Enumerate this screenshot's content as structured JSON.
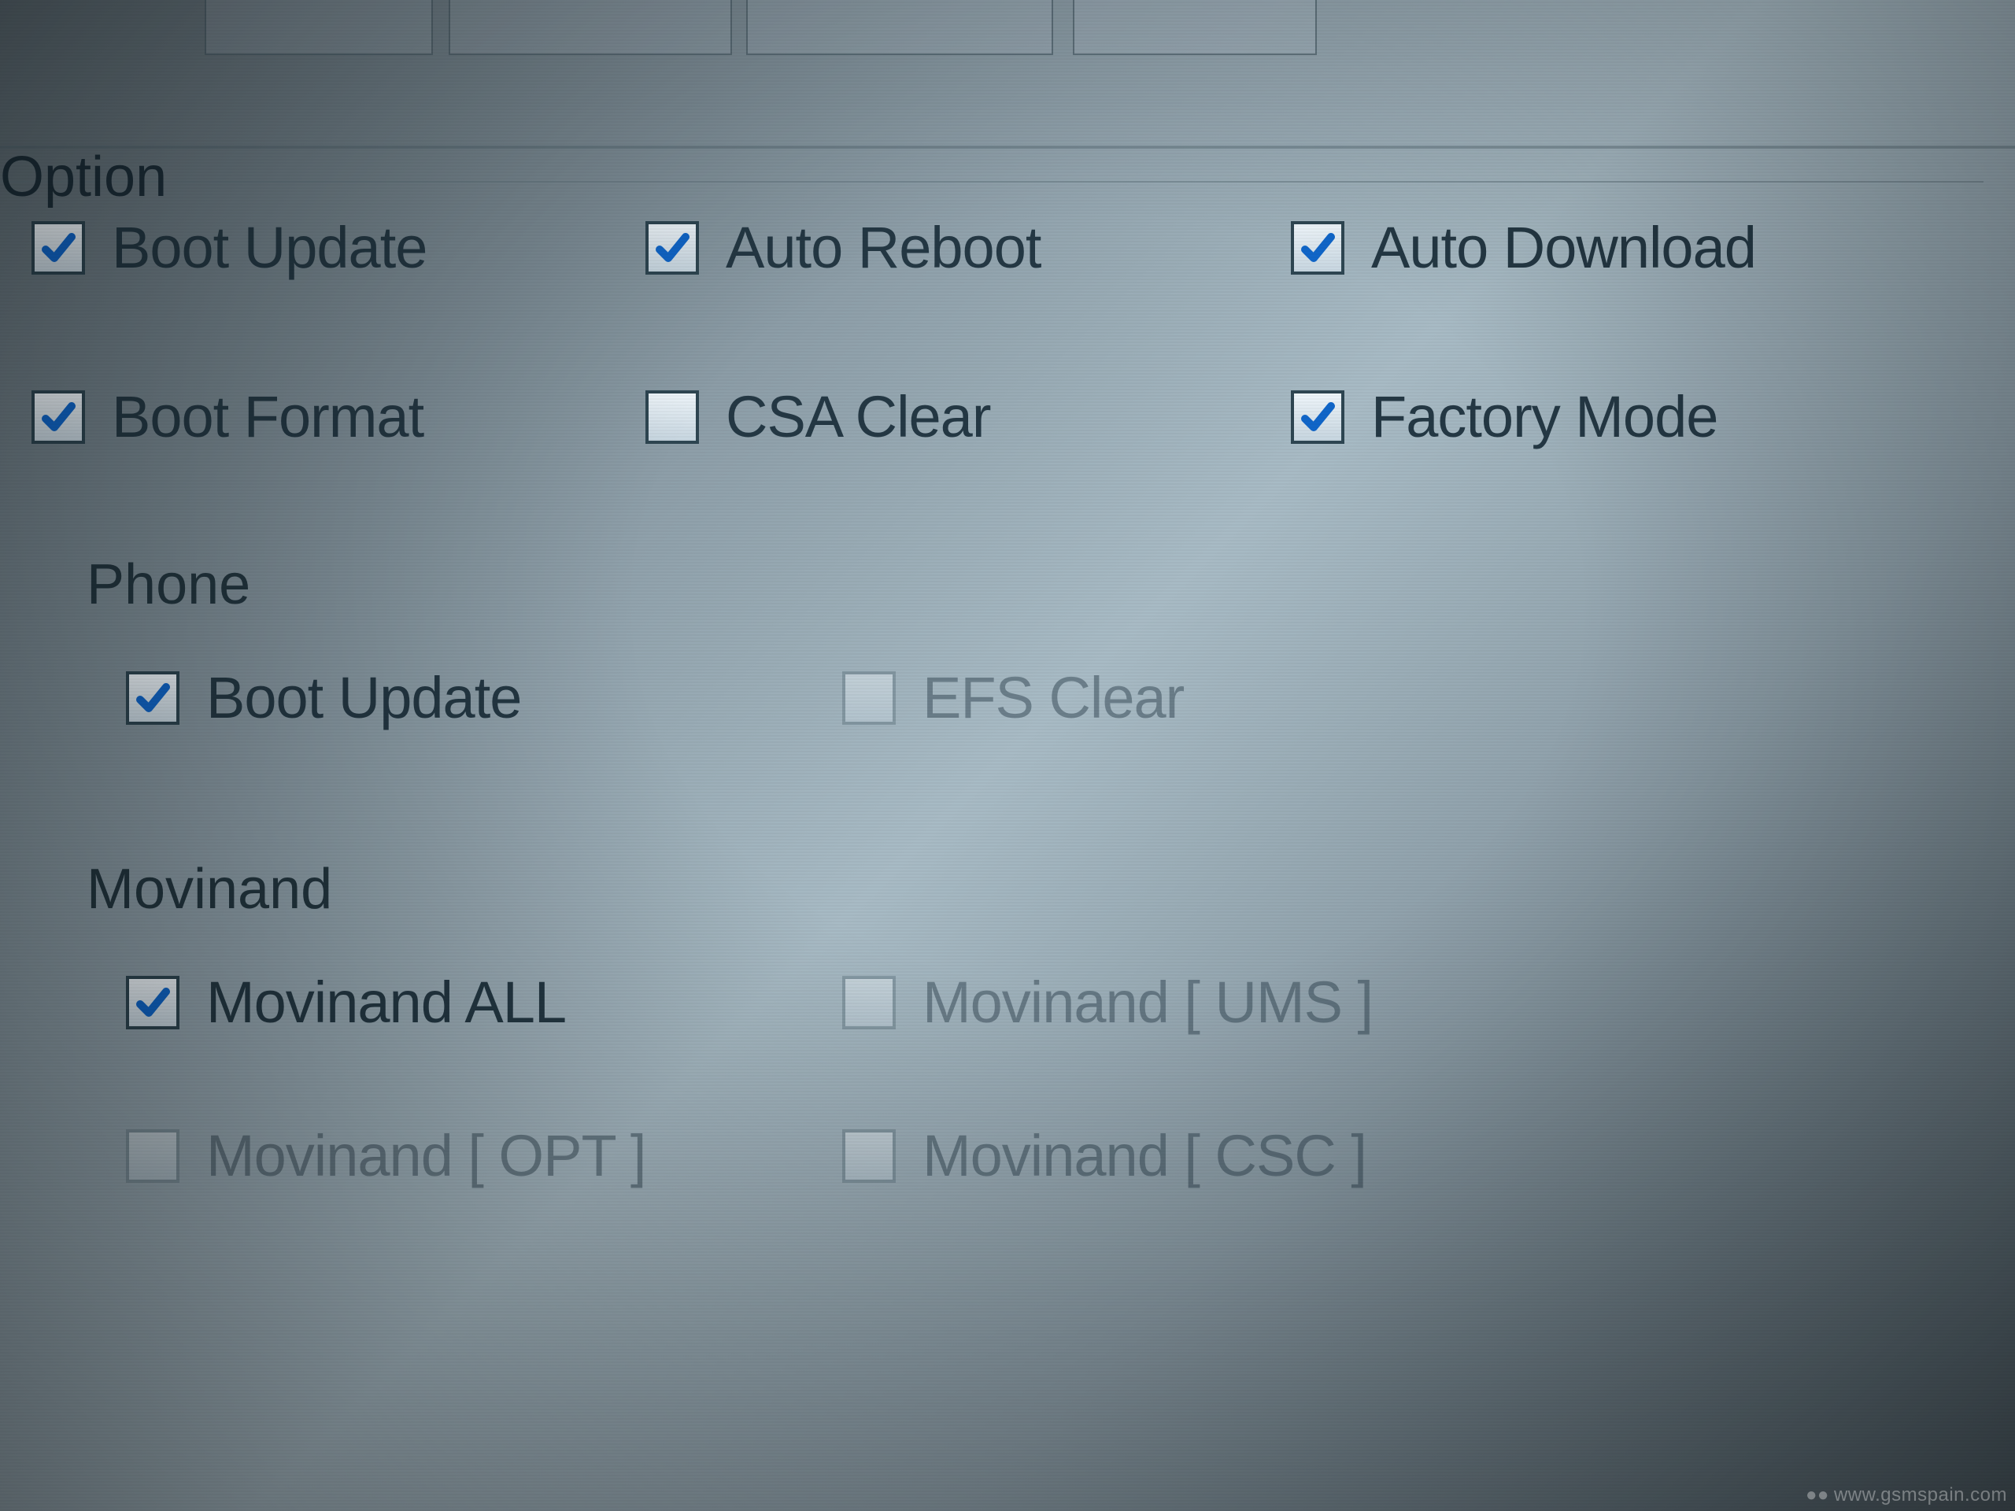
{
  "group": {
    "legend": "Option"
  },
  "options": {
    "boot_update": {
      "label": "Boot Update",
      "checked": true,
      "enabled": true
    },
    "auto_reboot": {
      "label": "Auto Reboot",
      "checked": true,
      "enabled": true
    },
    "auto_download": {
      "label": "Auto Download",
      "checked": true,
      "enabled": true
    },
    "boot_format": {
      "label": "Boot Format",
      "checked": true,
      "enabled": true
    },
    "csa_clear": {
      "label": "CSA Clear",
      "checked": false,
      "enabled": true
    },
    "factory_mode": {
      "label": "Factory Mode",
      "checked": true,
      "enabled": true
    }
  },
  "phone": {
    "legend": "Phone",
    "boot_update": {
      "label": "Boot Update",
      "checked": true,
      "enabled": true
    },
    "efs_clear": {
      "label": "EFS Clear",
      "checked": false,
      "enabled": false
    }
  },
  "movinand": {
    "legend": "Movinand",
    "all": {
      "label": "Movinand ALL",
      "checked": true,
      "enabled": true
    },
    "ums": {
      "label": "Movinand [ UMS ]",
      "checked": false,
      "enabled": false
    },
    "opt": {
      "label": "Movinand [ OPT ]",
      "checked": false,
      "enabled": false
    },
    "csc": {
      "label": "Movinand [ CSC ]",
      "checked": false,
      "enabled": false
    }
  },
  "watermark": "www.gsmspain.com"
}
